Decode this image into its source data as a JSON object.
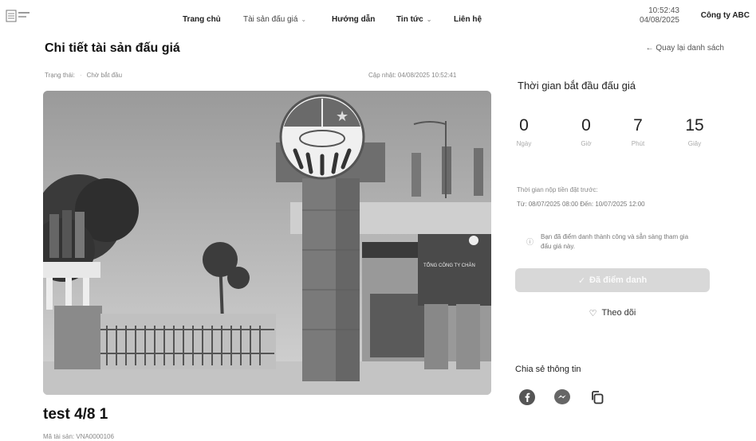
{
  "header": {
    "nav": [
      {
        "label": "Trang chủ",
        "dropdown": false
      },
      {
        "label": "Tài sản đấu giá",
        "dropdown": true
      },
      {
        "label": "Hướng dẫn",
        "dropdown": false
      },
      {
        "label": "Tin tức",
        "dropdown": true
      },
      {
        "label": "Liên hệ",
        "dropdown": false
      }
    ],
    "time": "10:52:43",
    "date": "04/08/2025",
    "company": "Công ty ABC"
  },
  "page": {
    "title": "Chi tiết tài sản đấu giá",
    "back_link": "← Quay lại danh sách",
    "status_label": "Trạng thái:",
    "status_value": "Chờ bắt đầu",
    "updated": "Cập nhật: 04/08/2025 10:52:41",
    "image_sign_text": "TỔNG CÔNG TY CHĂN",
    "asset_name": "test 4/8 1",
    "asset_code": "Mã tài sản: VNA0000106"
  },
  "countdown": {
    "title": "Thời gian bắt đầu đấu giá",
    "units": [
      {
        "value": "0",
        "label": "Ngày"
      },
      {
        "value": "0",
        "label": "Giờ"
      },
      {
        "value": "7",
        "label": "Phút"
      },
      {
        "value": "15",
        "label": "Giây"
      }
    ]
  },
  "deposit": {
    "label": "Thời gian nộp tiền đặt trước:",
    "range": "Từ: 08/07/2025 08:00 Đến: 10/07/2025 12:00"
  },
  "notice": "Bạn đã điểm danh thành công và sẵn sàng tham gia đấu giá này.",
  "actions": {
    "attended": "Đã điểm danh",
    "follow": "Theo dõi"
  },
  "share": {
    "title": "Chia sẻ thông tin",
    "icons": [
      "facebook-icon",
      "messenger-icon",
      "copy-icon"
    ]
  },
  "colors": {
    "button_disabled_bg": "#d8d8d8",
    "text_primary": "#222222",
    "text_muted": "#888888"
  }
}
